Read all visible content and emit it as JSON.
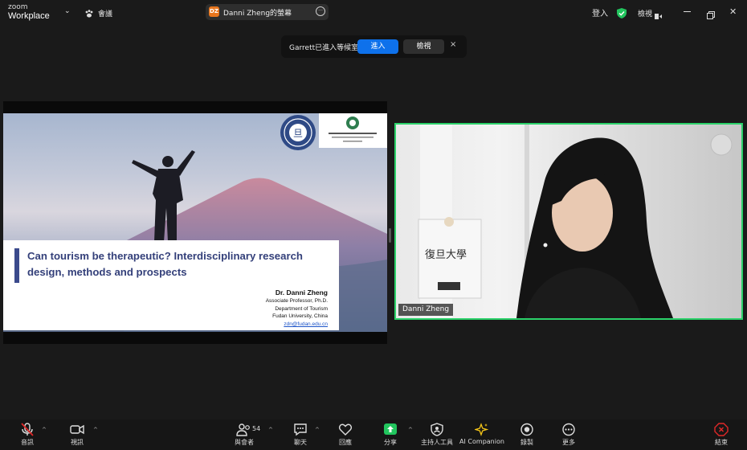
{
  "app": {
    "brand_line1": "zoom",
    "brand_line2": "Workplace",
    "meeting_label": "會議"
  },
  "window": {
    "title": "Danni Zheng的螢幕",
    "title_badge": "DZ"
  },
  "topright": {
    "signin": "登入",
    "view": "檢視"
  },
  "notification": {
    "message": "Garrett已進入等候室",
    "admit_label": "進入",
    "view_label": "檢視",
    "close_symbol": "×"
  },
  "slide": {
    "title": "Can tourism be therapeutic? Interdisciplinary research design, methods and prospects",
    "presenter": "Dr. Danni Zheng",
    "role": "Associate Professor, Ph.D.",
    "department": "Department of Tourism",
    "university": "Fudan University, China",
    "email": "zdn@fudan.edu.cn"
  },
  "video": {
    "participant_name": "Danni Zheng",
    "card_text": "復旦大學"
  },
  "toolbar": {
    "audio": "音訊",
    "video": "視訊",
    "participants": "與會者",
    "participant_count": "54",
    "chat": "聊天",
    "reactions": "回應",
    "share": "分享",
    "host_tools": "主持人工具",
    "ai_companion": "AI Companion",
    "record": "錄製",
    "more": "更多",
    "end": "結束"
  },
  "colors": {
    "accent_blue": "#0e71eb",
    "active_speaker": "#2bd26a",
    "share_green": "#22c55e",
    "end_red": "#e02828",
    "title_badge": "#e8761e"
  }
}
